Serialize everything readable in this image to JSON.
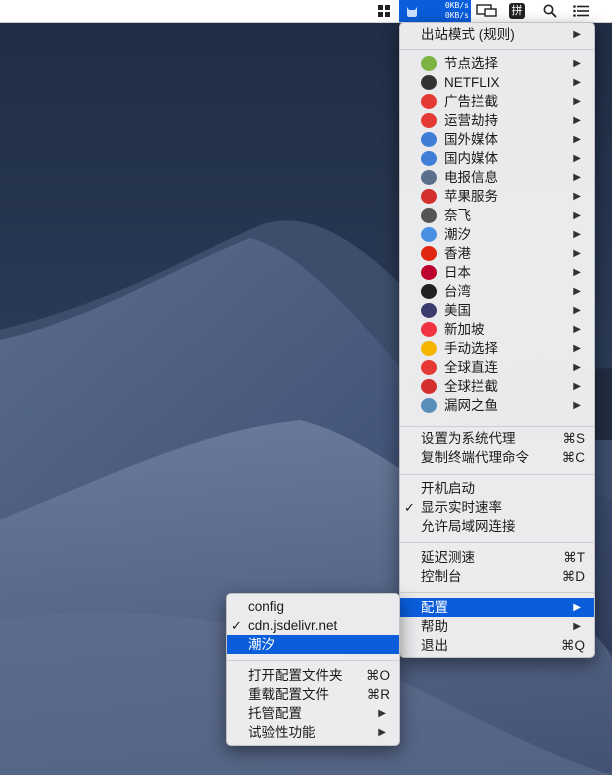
{
  "menubar": {
    "speed_up": "0KB/s",
    "speed_down": "0KB/s",
    "icons": [
      "grid-app-icon",
      "clash-cat-icon",
      "display-mirror-icon",
      "input-method-icon",
      "spotlight-search-icon",
      "control-list-icon"
    ],
    "input_method_glyph": "拼"
  },
  "main_menu": {
    "outbound_mode": "出站模式 (规则)",
    "proxy_groups": [
      {
        "label": "节点选择",
        "icon": "beginner-badge-icon",
        "color": "#7cb342"
      },
      {
        "label": "NETFLIX",
        "icon": "movie-camera-icon",
        "color": "#333333"
      },
      {
        "label": "广告拦截",
        "icon": "no-entry-icon",
        "color": "#e53935"
      },
      {
        "label": "运营劫持",
        "icon": "prohibited-icon",
        "color": "#e53935"
      },
      {
        "label": "国外媒体",
        "icon": "globe-icon",
        "color": "#3f7ed6"
      },
      {
        "label": "国内媒体",
        "icon": "globe-asia-icon",
        "color": "#3f7ed6"
      },
      {
        "label": "电报信息",
        "icon": "mobile-phone-arrow-icon",
        "color": "#5b6f8c"
      },
      {
        "label": "苹果服务",
        "icon": "apple-icon",
        "color": "#d32f2f"
      },
      {
        "label": "奈飞",
        "icon": "film-projector-icon",
        "color": "#555555"
      },
      {
        "label": "潮汐",
        "icon": "whale-icon",
        "color": "#4a90e2"
      },
      {
        "label": "香港",
        "icon": "hk-flag-icon",
        "color": "#de2910"
      },
      {
        "label": "日本",
        "icon": "jp-flag-icon",
        "color": "#bc002d"
      },
      {
        "label": "台湾",
        "icon": "missing-glyph-icon",
        "color": "#222222"
      },
      {
        "label": "美国",
        "icon": "us-flag-icon",
        "color": "#3c3b6e"
      },
      {
        "label": "新加坡",
        "icon": "sg-flag-icon",
        "color": "#ef3340"
      },
      {
        "label": "手动选择",
        "icon": "ok-hand-icon",
        "color": "#f5b400"
      },
      {
        "label": "全球直连",
        "icon": "direct-hit-icon",
        "color": "#e53935"
      },
      {
        "label": "全球拦截",
        "icon": "stop-sign-icon",
        "color": "#d32f2f"
      },
      {
        "label": "漏网之鱼",
        "icon": "fish-icon",
        "color": "#5b8fb9"
      }
    ],
    "set_system_proxy": {
      "label": "设置为系统代理",
      "shortcut": "⌘S"
    },
    "copy_shell_cmd": {
      "label": "复制终端代理命令",
      "shortcut": "⌘C"
    },
    "launch_at_login": "开机启动",
    "show_speed": "显示实时速率",
    "allow_lan": "允许局域网连接",
    "latency_test": {
      "label": "延迟测速",
      "shortcut": "⌘T"
    },
    "dashboard": {
      "label": "控制台",
      "shortcut": "⌘D"
    },
    "config": "配置",
    "help": "帮助",
    "quit": {
      "label": "退出",
      "shortcut": "⌘Q"
    }
  },
  "config_submenu": {
    "profiles": [
      "config",
      "cdn.jsdelivr.net",
      "潮汐"
    ],
    "open_config_folder": {
      "label": "打开配置文件夹",
      "shortcut": "⌘O"
    },
    "reload_config": {
      "label": "重载配置文件",
      "shortcut": "⌘R"
    },
    "managed_config": "托管配置",
    "experimental": "试验性功能"
  },
  "glyphs": {
    "arrow": "▶",
    "check": "✓"
  }
}
